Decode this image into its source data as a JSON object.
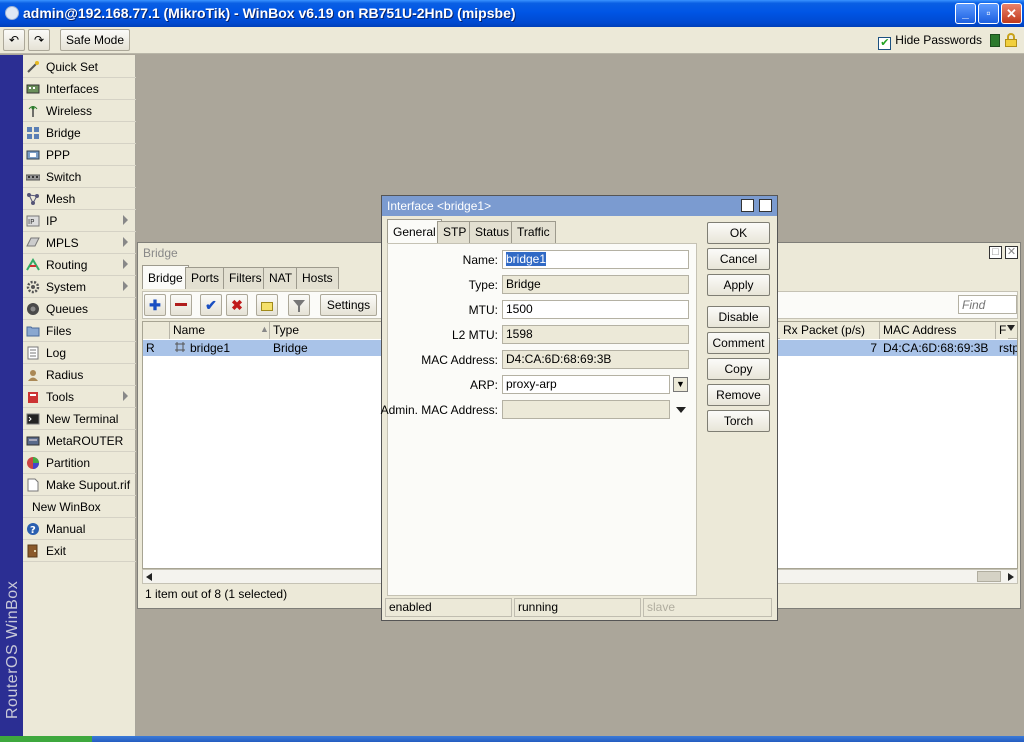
{
  "window": {
    "title": "admin@192.168.77.1 (MikroTik) - WinBox v6.19 on RB751U-2HnD (mipsbe)",
    "minimize": "_",
    "maximize": "▫",
    "close": "✕"
  },
  "toolbar": {
    "undo": "↶",
    "redo": "↷",
    "safe_mode": "Safe Mode",
    "hide_passwords_check": "✔",
    "hide_passwords": "Hide Passwords"
  },
  "sidebar": {
    "brand": "RouterOS WinBox",
    "items": [
      {
        "label": "Quick Set",
        "icon": "wand-icon"
      },
      {
        "label": "Interfaces",
        "icon": "interfaces-icon"
      },
      {
        "label": "Wireless",
        "icon": "wireless-icon"
      },
      {
        "label": "Bridge",
        "icon": "bridge-icon"
      },
      {
        "label": "PPP",
        "icon": "ppp-icon"
      },
      {
        "label": "Switch",
        "icon": "switch-icon"
      },
      {
        "label": "Mesh",
        "icon": "mesh-icon"
      },
      {
        "label": "IP",
        "icon": "ip-icon"
      },
      {
        "label": "MPLS",
        "icon": "mpls-icon"
      },
      {
        "label": "Routing",
        "icon": "routing-icon"
      },
      {
        "label": "System",
        "icon": "system-icon"
      },
      {
        "label": "Queues",
        "icon": "queues-icon"
      },
      {
        "label": "Files",
        "icon": "folder-icon"
      },
      {
        "label": "Log",
        "icon": "log-icon"
      },
      {
        "label": "Radius",
        "icon": "radius-icon"
      },
      {
        "label": "Tools",
        "icon": "tools-icon"
      },
      {
        "label": "New Terminal",
        "icon": "terminal-icon"
      },
      {
        "label": "MetaROUTER",
        "icon": "metarouter-icon"
      },
      {
        "label": "Partition",
        "icon": "partition-icon"
      },
      {
        "label": "Make Supout.rif",
        "icon": "document-icon"
      },
      {
        "label": "New WinBox",
        "icon": ""
      },
      {
        "label": "Manual",
        "icon": "help-icon"
      },
      {
        "label": "Exit",
        "icon": "exit-icon"
      }
    ]
  },
  "bridge_window": {
    "title": "Bridge",
    "tabs": [
      "Bridge",
      "Ports",
      "Filters",
      "NAT",
      "Hosts"
    ],
    "settings_label": "Settings",
    "find_placeholder": "Find",
    "columns": {
      "flag": "",
      "name": "Name",
      "type": "Type",
      "rx_packet": "Rx Packet (p/s)",
      "mac": "MAC Address",
      "last": "F"
    },
    "rows": [
      {
        "flag": "R",
        "name": "bridge1",
        "type": "Bridge",
        "rx_packet": "7",
        "mac": "D4:CA:6D:68:69:3B",
        "last": "rstp"
      }
    ],
    "status": "1 item out of 8 (1 selected)"
  },
  "dialog": {
    "title": "Interface <bridge1>",
    "tabs": [
      "General",
      "STP",
      "Status",
      "Traffic"
    ],
    "fields": {
      "name_label": "Name:",
      "name_value": "bridge1",
      "type_label": "Type:",
      "type_value": "Bridge",
      "mtu_label": "MTU:",
      "mtu_value": "1500",
      "l2mtu_label": "L2 MTU:",
      "l2mtu_value": "1598",
      "mac_label": "MAC Address:",
      "mac_value": "D4:CA:6D:68:69:3B",
      "arp_label": "ARP:",
      "arp_value": "proxy-arp",
      "admin_mac_label": "Admin. MAC Address:",
      "admin_mac_value": ""
    },
    "buttons": [
      "OK",
      "Cancel",
      "Apply",
      "Disable",
      "Comment",
      "Copy",
      "Remove",
      "Torch"
    ],
    "status": [
      "enabled",
      "running",
      "slave"
    ]
  }
}
